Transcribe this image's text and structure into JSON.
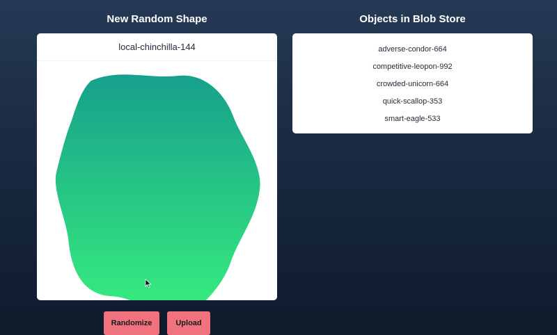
{
  "headings": {
    "left": "New Random Shape",
    "right": "Objects in Blob Store"
  },
  "shape": {
    "name": "local-chinchilla-144",
    "gradient_top": "#16a08c",
    "gradient_bottom": "#38ef7d"
  },
  "store": {
    "items": [
      "adverse-condor-664",
      "competitive-leopon-992",
      "crowded-unicorn-664",
      "quick-scallop-353",
      "smart-eagle-533"
    ]
  },
  "buttons": {
    "randomize": "Randomize",
    "upload": "Upload",
    "color": "#f0727e"
  }
}
